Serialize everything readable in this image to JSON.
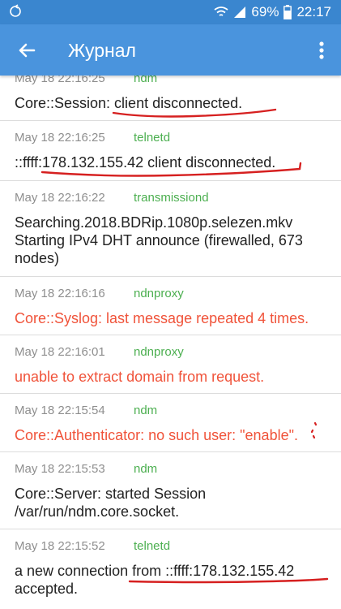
{
  "status_bar": {
    "battery": "69%",
    "time": "22:17"
  },
  "app_bar": {
    "title": "Журнал",
    "back_icon": "arrow-back-icon",
    "menu_icon": "more-vert-icon"
  },
  "colors": {
    "app_bar": "#4a94dd",
    "status_bar": "#3a86cf",
    "process": "#4caf50",
    "error": "#f0533a",
    "annotation": "#d62020"
  },
  "entries": [
    {
      "time": "May 18 22:16:25",
      "process": "ndm",
      "message": "Core::Session: client disconnected.",
      "level": "info"
    },
    {
      "time": "May 18 22:16:25",
      "process": "telnetd",
      "message": "::ffff:178.132.155.42 client disconnected.",
      "level": "info"
    },
    {
      "time": "May 18 22:16:22",
      "process": "transmissiond",
      "message": "Searching.2018.BDRip.1080p.selezen.mkv Starting IPv4 DHT announce (firewalled, 673 nodes)",
      "level": "info"
    },
    {
      "time": "May 18 22:16:16",
      "process": "ndnproxy",
      "message": "Core::Syslog: last message repeated 4 times.",
      "level": "error"
    },
    {
      "time": "May 18 22:16:01",
      "process": "ndnproxy",
      "message": "unable to extract domain from request.",
      "level": "error"
    },
    {
      "time": "May 18 22:15:54",
      "process": "ndm",
      "message": "Core::Authenticator: no such user: \"enable\".",
      "level": "error"
    },
    {
      "time": "May 18 22:15:53",
      "process": "ndm",
      "message": "Core::Server: started Session /var/run/ndm.core.socket.",
      "level": "info"
    },
    {
      "time": "May 18 22:15:52",
      "process": "telnetd",
      "message": "a new connection from ::ffff:178.132.155.42 accepted.",
      "level": "info"
    }
  ]
}
